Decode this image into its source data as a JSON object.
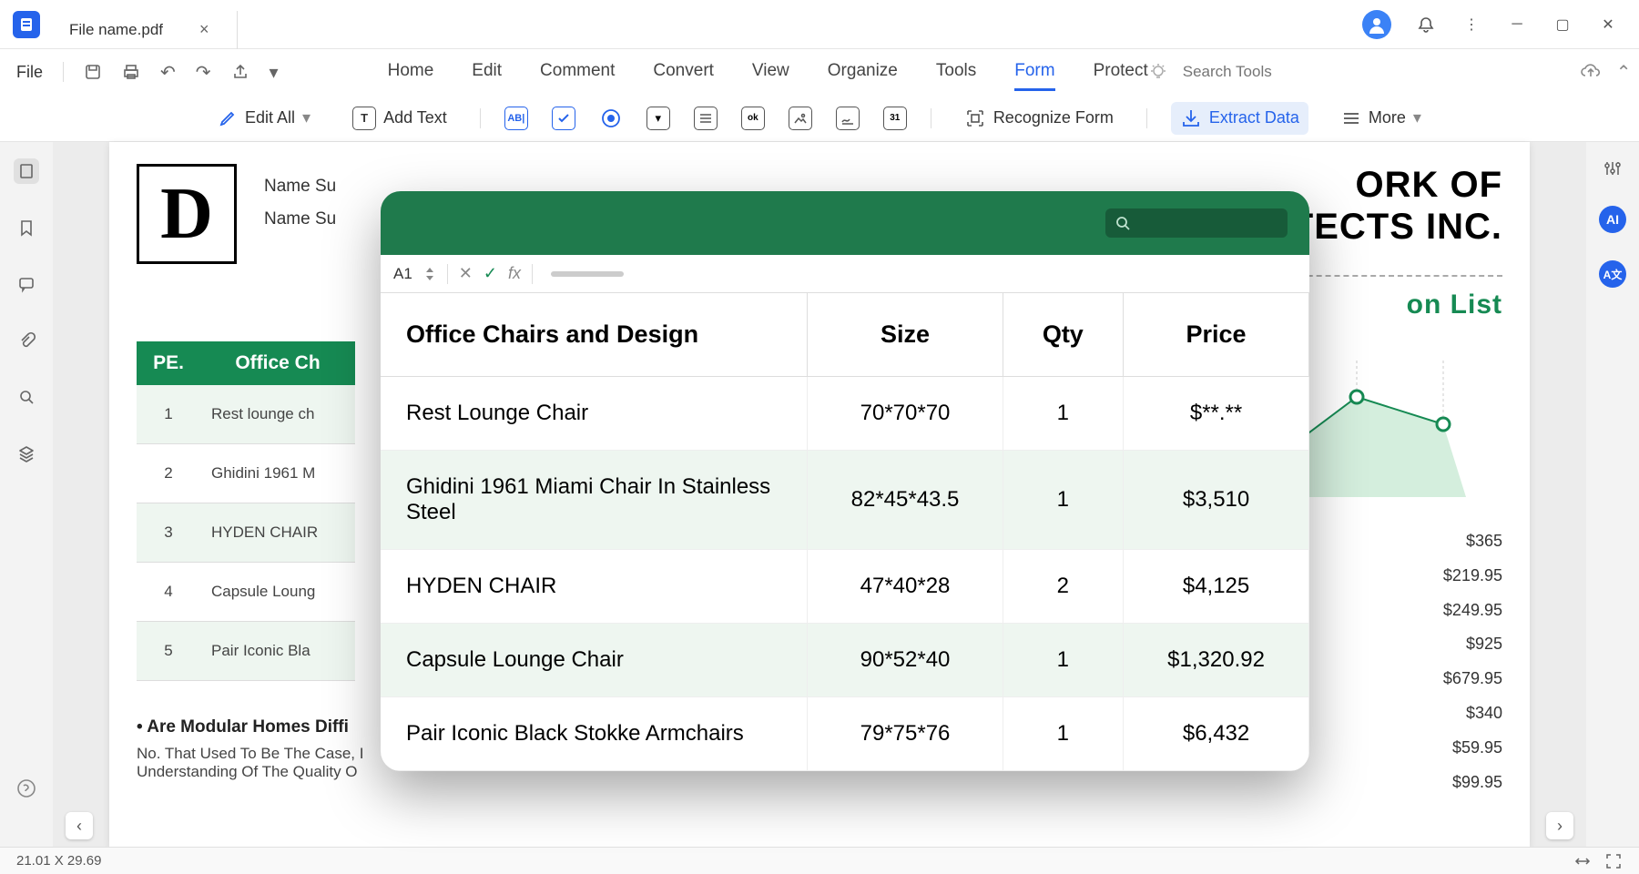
{
  "app": {
    "tab_name": "File name.pdf"
  },
  "quickbar": {
    "file": "File"
  },
  "menu": {
    "items": [
      "Home",
      "Edit",
      "Comment",
      "Convert",
      "View",
      "Organize",
      "Tools",
      "Form",
      "Protect"
    ],
    "active_index": 7,
    "search_placeholder": "Search Tools"
  },
  "ribbon": {
    "edit_all": "Edit All",
    "add_text": "Add Text",
    "recognize_form": "Recognize Form",
    "extract_data": "Extract Data",
    "more": "More"
  },
  "document": {
    "logo_letter": "D",
    "meta1": "Name Su",
    "meta2": "Name Su",
    "title_line1": "ORK OF",
    "title_line2": "ITECTS INC.",
    "subtitle": "on List",
    "bg_table": {
      "headers": [
        "PE.",
        "Office Ch"
      ],
      "rows": [
        [
          "1",
          "Rest lounge ch"
        ],
        [
          "2",
          "Ghidini 1961 M"
        ],
        [
          "3",
          "HYDEN CHAIR"
        ],
        [
          "4",
          "Capsule Loung"
        ],
        [
          "5",
          "Pair Iconic Bla"
        ]
      ]
    },
    "question": "• Are Modular Homes Diffi",
    "answer": "No. That Used To Be The Case, I\nUnderstanding Of The Quality O",
    "prices": [
      "$365",
      "$219.95",
      "$249.95",
      "$925",
      "$679.95",
      "$340",
      "$59.95",
      "$99.95"
    ]
  },
  "overlay": {
    "cell_name": "A1",
    "search_placeholder": "",
    "headers": [
      "Office Chairs and Design",
      "Size",
      "Qty",
      "Price"
    ],
    "rows": [
      {
        "name": "Rest Lounge Chair",
        "size": "70*70*70",
        "qty": "1",
        "price": "$**.**"
      },
      {
        "name": "Ghidini 1961 Miami Chair In Stainless Steel",
        "size": "82*45*43.5",
        "qty": "1",
        "price": "$3,510"
      },
      {
        "name": "HYDEN CHAIR",
        "size": "47*40*28",
        "qty": "2",
        "price": "$4,125"
      },
      {
        "name": "Capsule Lounge Chair",
        "size": "90*52*40",
        "qty": "1",
        "price": "$1,320.92"
      },
      {
        "name": "Pair Iconic Black Stokke Armchairs",
        "size": "79*75*76",
        "qty": "1",
        "price": "$6,432"
      }
    ]
  },
  "statusbar": {
    "page_size": "21.01 X 29.69"
  }
}
